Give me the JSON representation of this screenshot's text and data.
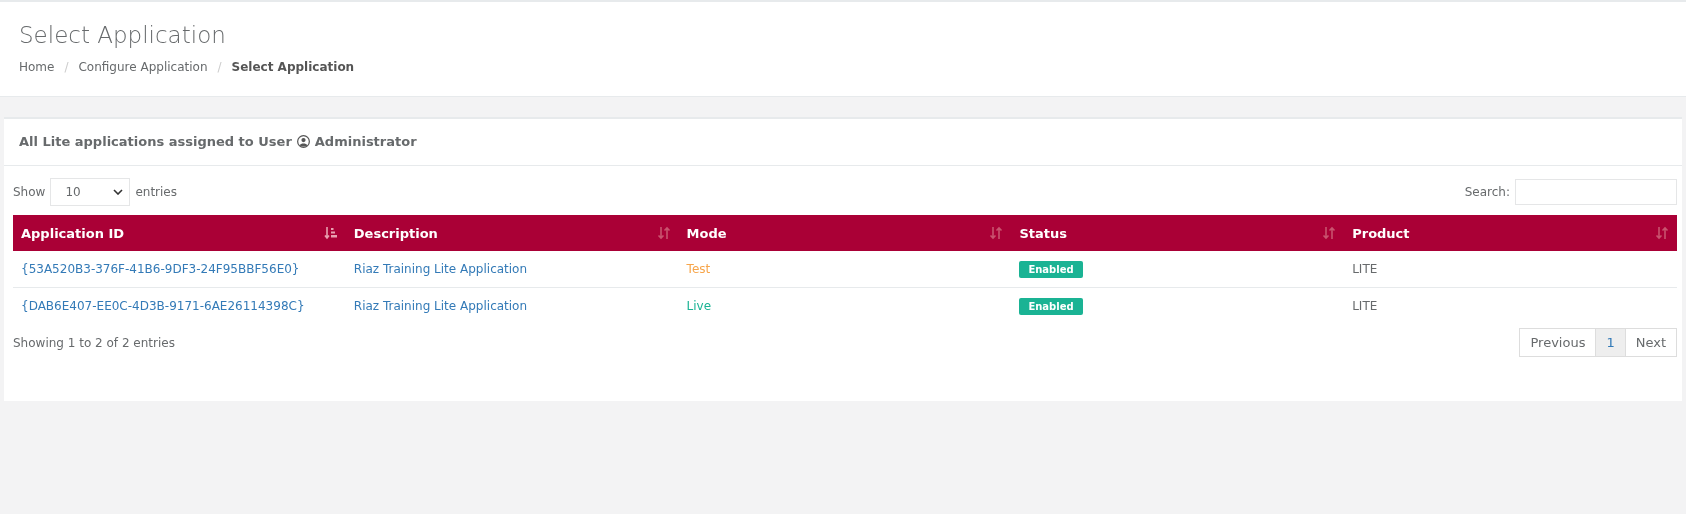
{
  "page_title": "Select Application",
  "breadcrumb_separator": "/",
  "breadcrumb": [
    {
      "label": "Home",
      "current": false
    },
    {
      "label": "Configure Application",
      "current": false
    },
    {
      "label": "Select Application",
      "current": true
    }
  ],
  "panel": {
    "title": "All Lite applications assigned to User",
    "user": "Administrator"
  },
  "length_control": {
    "before": "Show",
    "value": "10",
    "after": "entries"
  },
  "search": {
    "label": "Search:"
  },
  "table": {
    "columns": [
      {
        "label": "Application ID",
        "sorted": true
      },
      {
        "label": "Description",
        "sorted": false
      },
      {
        "label": "Mode",
        "sorted": false
      },
      {
        "label": "Status",
        "sorted": false
      },
      {
        "label": "Product",
        "sorted": false
      }
    ],
    "rows": [
      {
        "application_id": "{53A520B3-376F-41B6-9DF3-24F95BBF56E0}",
        "description": "Riaz Training Lite Application",
        "mode": {
          "text": "Test",
          "color": "#f7a54a"
        },
        "status": "Enabled",
        "product": "LITE"
      },
      {
        "application_id": "{DAB6E407-EE0C-4D3B-9171-6AE26114398C}",
        "description": "Riaz Training Lite Application",
        "mode": {
          "text": "Live",
          "color": "#1bb394"
        },
        "status": "Enabled",
        "product": "LITE"
      }
    ]
  },
  "info": "Showing 1 to 2 of 2 entries",
  "pagination": [
    {
      "label": "Previous",
      "selected": false
    },
    {
      "label": "1",
      "selected": true
    },
    {
      "label": "Next",
      "selected": false
    }
  ]
}
